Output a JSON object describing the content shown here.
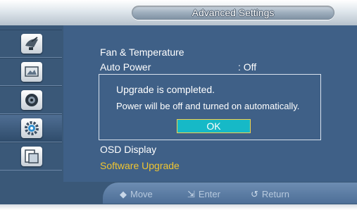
{
  "header": {
    "title": "Advanced Settings"
  },
  "sidebar": {
    "items": [
      {
        "icon": "satellite-dish-icon",
        "active": false
      },
      {
        "icon": "picture-icon",
        "active": false
      },
      {
        "icon": "speaker-icon",
        "active": false
      },
      {
        "icon": "gear-icon",
        "active": true
      },
      {
        "icon": "multi-screen-icon",
        "active": false
      }
    ]
  },
  "menu": {
    "fan_temperature": "Fan & Temperature",
    "auto_power_label": "Auto Power",
    "auto_power_value": ": Off",
    "osd_display": "OSD Display",
    "software_upgrade": "Software Upgrade"
  },
  "dialog": {
    "line1": "Upgrade is completed.",
    "line2": "Power will be off and turned on automatically.",
    "ok_label": "OK"
  },
  "footer": {
    "move_glyph": "◆",
    "move_label": "Move",
    "enter_glyph": "⇲",
    "enter_label": "Enter",
    "return_glyph": "↺",
    "return_label": "Return"
  },
  "colors": {
    "panel": "#3f6087",
    "highlight_text": "#f0c531",
    "ok_button": "#16b9c7"
  }
}
